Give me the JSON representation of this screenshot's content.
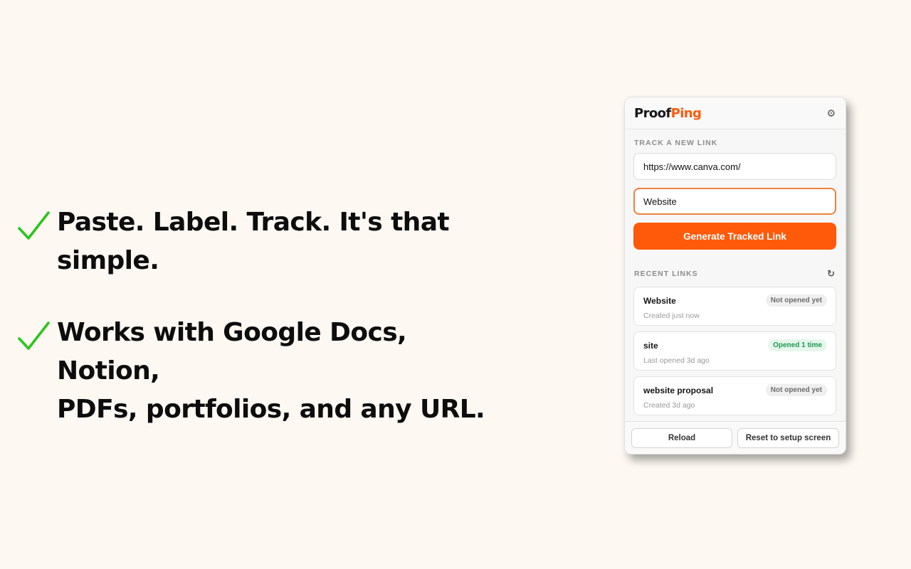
{
  "features": [
    {
      "line1": "Paste. Label. Track. It's that",
      "line2": "simple."
    },
    {
      "line1": "Works with Google Docs, Notion,",
      "line2": "PDFs, portfolios, and any URL."
    }
  ],
  "popup": {
    "brand_part1": "Proof",
    "brand_part2": "Ping",
    "settings_icon": "gear-icon",
    "track_label": "TRACK A NEW LINK",
    "url_value": "https://www.canva.com/",
    "label_value": "Website",
    "generate_label": "Generate Tracked Link",
    "recent_label": "RECENT LINKS",
    "refresh_icon": "refresh-icon",
    "links": [
      {
        "title": "Website",
        "subtitle": "Created just now",
        "status": "Not opened yet"
      },
      {
        "title": "site",
        "subtitle": "Last opened 3d ago",
        "status": "Opened 1 time"
      },
      {
        "title": "website proposal",
        "subtitle": "Created 3d ago",
        "status": "Not opened yet"
      }
    ],
    "footer": {
      "reload_label": "Reload",
      "reset_label": "Reset to setup screen"
    }
  },
  "colors": {
    "background": "#fdf8f2",
    "accent": "#ff5a0a",
    "check_green": "#2bc41e",
    "opened_green": "#1d9a51"
  }
}
